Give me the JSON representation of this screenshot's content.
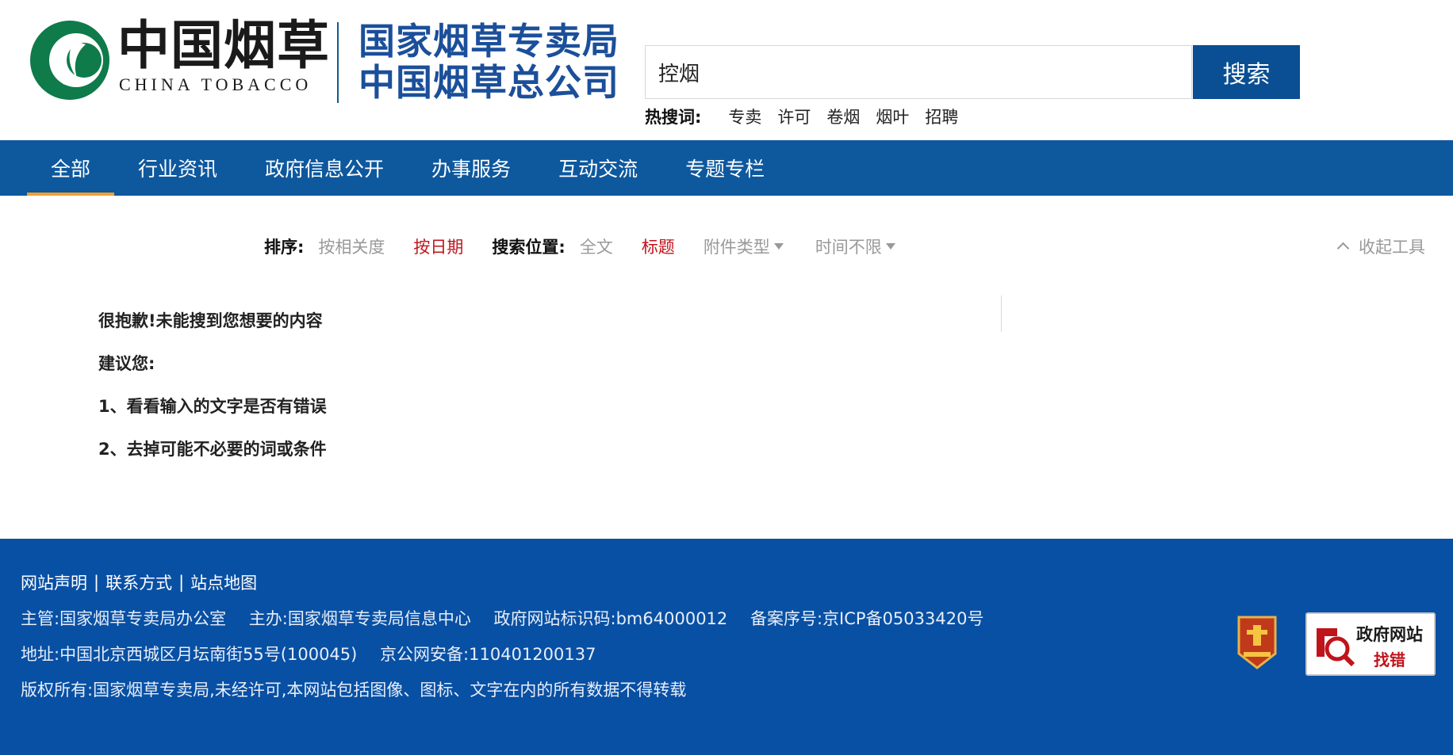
{
  "header": {
    "brand_cn": "中国烟草",
    "brand_en": "CHINA TOBACCO",
    "org_line1": "国家烟草专卖局",
    "org_line2": "中国烟草总公司"
  },
  "search": {
    "value": "控烟",
    "button_label": "搜索",
    "hot_label": "热搜词:",
    "hot_words": [
      "专卖",
      "许可",
      "卷烟",
      "烟叶",
      "招聘"
    ]
  },
  "nav": {
    "items": [
      "全部",
      "行业资讯",
      "政府信息公开",
      "办事服务",
      "互动交流",
      "专题专栏"
    ],
    "active_index": 0
  },
  "toolbar": {
    "sort_label": "排序:",
    "sort_relevance": "按相关度",
    "sort_date": "按日期",
    "position_label": "搜索位置:",
    "pos_fulltext": "全文",
    "pos_title": "标题",
    "attachment_type": "附件类型",
    "time_range": "时间不限",
    "collapse_label": "收起工具",
    "active_color": "#c0141b"
  },
  "results": {
    "msg1": "很抱歉!未能搜到您想要的内容",
    "msg2": "建议您:",
    "msg3": "1、看看输入的文字是否有错误",
    "msg4": "2、去掉可能不必要的词或条件"
  },
  "footer": {
    "links": [
      "网站声明",
      "联系方式",
      "站点地图"
    ],
    "link_sep": "|",
    "supervisor": "主管:国家烟草专卖局办公室",
    "sponsor": "主办:国家烟草专卖局信息中心",
    "gov_code": "政府网站标识码:bm64000012",
    "icp": "备案序号:京ICP备05033420号",
    "address": "地址:中国北京西城区月坛南街55号(100045)",
    "police": "京公网安备:110401200137",
    "copyright": "版权所有:国家烟草专卖局,未经许可,本网站包括图像、图标、文字在内的所有数据不得转载",
    "gov_badge_line1": "政府网站",
    "gov_badge_line2": "找错"
  },
  "colors": {
    "nav_bg": "#0e589e",
    "footer_bg": "#0850a4",
    "search_btn": "#0a4f93",
    "accent_underline": "#f0a030",
    "logo_green": "#0f7a4a"
  }
}
